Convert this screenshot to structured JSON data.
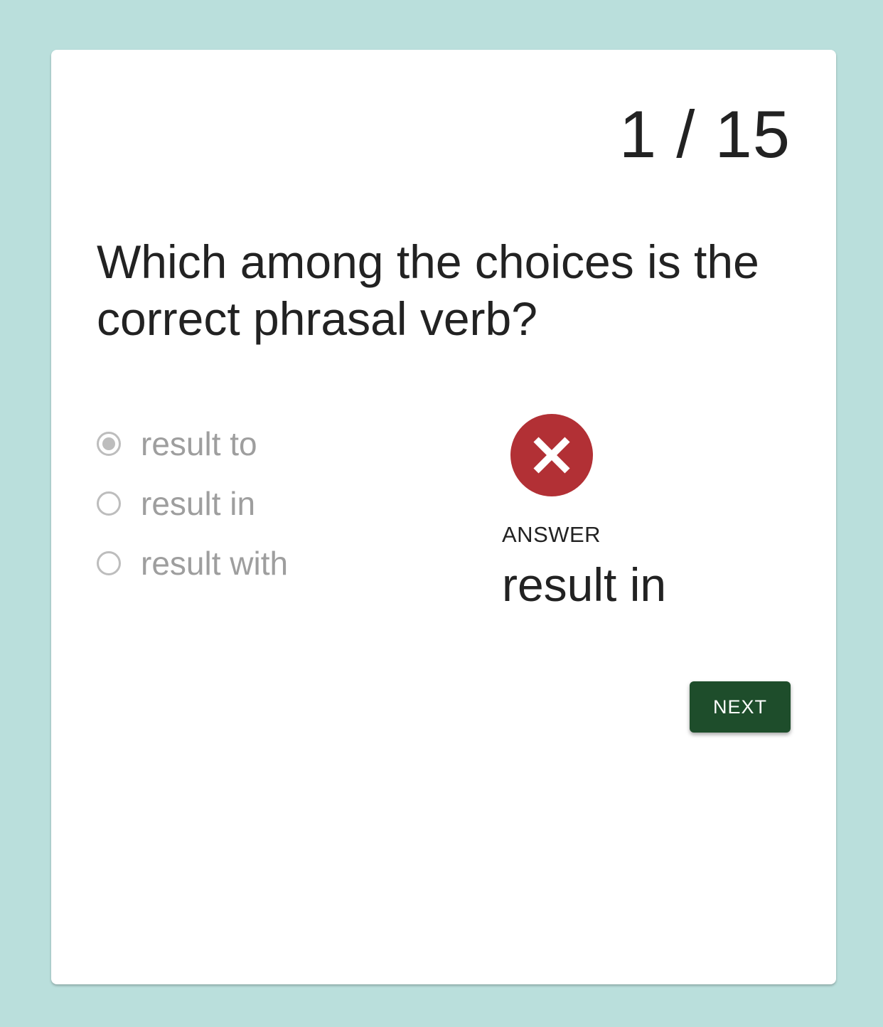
{
  "progress": {
    "label": "1 / 15",
    "current": 1,
    "total": 15
  },
  "question": {
    "text": "Which among the choices is the correct phrasal verb?"
  },
  "choices": [
    {
      "label": "result to",
      "selected": true
    },
    {
      "label": "result in",
      "selected": false
    },
    {
      "label": "result with",
      "selected": false
    }
  ],
  "result": {
    "status": "incorrect",
    "icon": "x-circle-icon",
    "color": "#b23035",
    "caption": "ANSWER",
    "answer": "result in"
  },
  "actions": {
    "next_label": "NEXT"
  },
  "colors": {
    "background": "#badfdc",
    "card": "#ffffff",
    "button": "#1e4d2b",
    "disabled_text": "#9e9e9e"
  }
}
